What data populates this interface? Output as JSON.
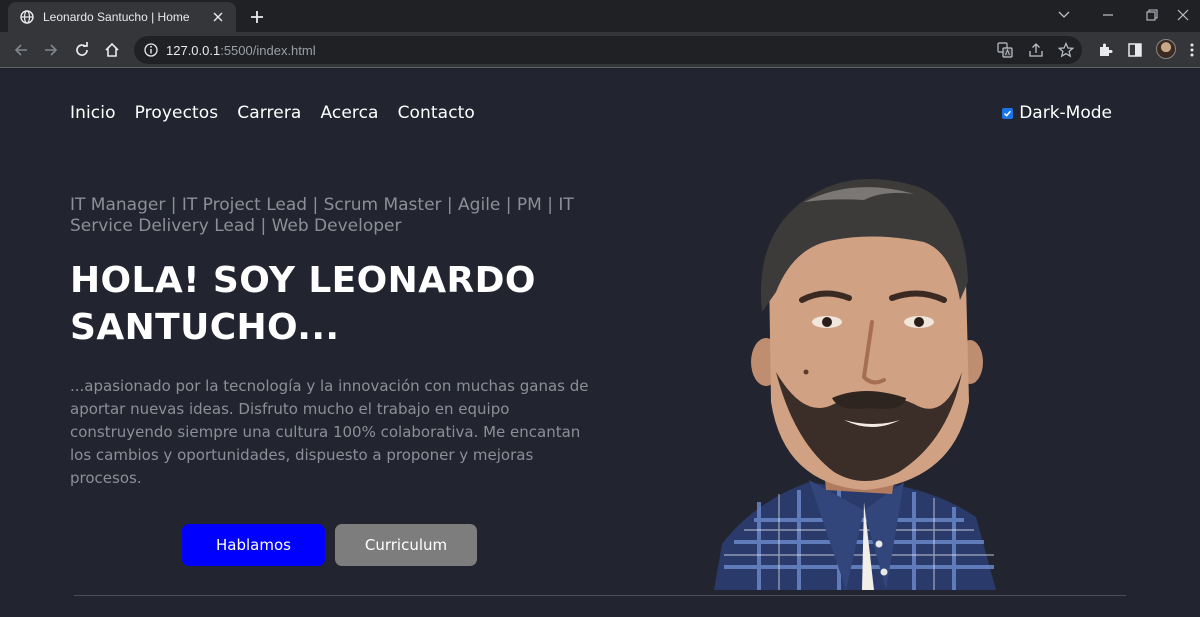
{
  "browser": {
    "tab_title": "Leonardo Santucho | Home",
    "url_host": "127.0.0.1",
    "url_path": ":5500/index.html"
  },
  "nav": {
    "items": [
      "Inicio",
      "Proyectos",
      "Carrera",
      "Acerca",
      "Contacto"
    ],
    "dark_mode_label": "Dark-Mode",
    "dark_mode_checked": true
  },
  "hero": {
    "subtitle": "IT Manager | IT Project Lead | Scrum Master | Agile | PM | IT Service Delivery Lead | Web Developer",
    "headline": "HOLA! SOY LEONARDO SANTUCHO...",
    "description": "...apasionado por la tecnología y la innovación con muchas ganas de aportar nuevas ideas. Disfruto mucho el trabajo en equipo construyendo siempre una cultura 100% colaborativa. Me encantan los cambios y oportunidades, dispuesto a proponer y mejoras procesos.",
    "primary_button": "Hablamos",
    "secondary_button": "Curriculum"
  },
  "colors": {
    "page_bg": "#22252f",
    "primary_button": "#0000ff",
    "secondary_button": "#7d7d7d",
    "muted_text": "#8c8f97"
  }
}
